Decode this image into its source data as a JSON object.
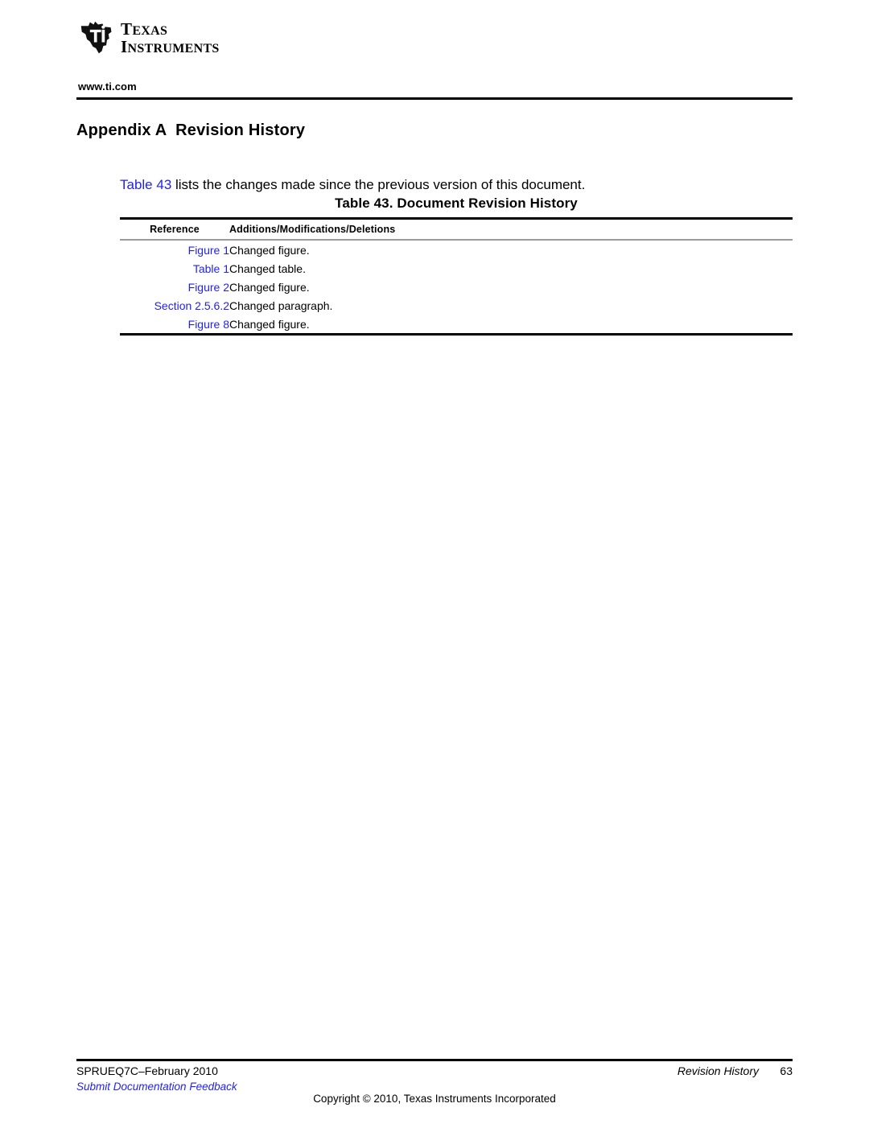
{
  "header": {
    "logo": {
      "mark_icon": "ti-texas-logo-icon",
      "line1": "TEXAS",
      "line2": "INSTRUMENTS",
      "line1_cap": "T",
      "line1_rest": "EXAS",
      "line2_cap": "I",
      "line2_rest": "NSTRUMENTS"
    },
    "site_url": "www.ti.com"
  },
  "title": "Appendix A  Revision History",
  "intro": {
    "link_text": "Table 43",
    "rest_text": " lists the changes made since the previous version of this document."
  },
  "table": {
    "caption": "Table 43. Document Revision History",
    "columns": [
      "Reference",
      "Additions/Modifications/Deletions"
    ],
    "rows": [
      {
        "reference": "Figure 1",
        "description": "Changed figure."
      },
      {
        "reference": "Table 1",
        "description": "Changed table."
      },
      {
        "reference": "Figure 2",
        "description": "Changed figure."
      },
      {
        "reference": "Section 2.5.6.2",
        "description": "Changed paragraph."
      },
      {
        "reference": "Figure 8",
        "description": "Changed figure."
      }
    ]
  },
  "footer": {
    "document_id": "SPRUEQ7C–February 2010",
    "feedback_link": "Submit Documentation Feedback",
    "section_name": "Revision History",
    "page_number": "63",
    "copyright": "Copyright © 2010, Texas Instruments Incorporated"
  },
  "colors": {
    "link_blue": "#2222ee",
    "rule_black": "#000000",
    "rule_gray": "#9a9a9a"
  }
}
